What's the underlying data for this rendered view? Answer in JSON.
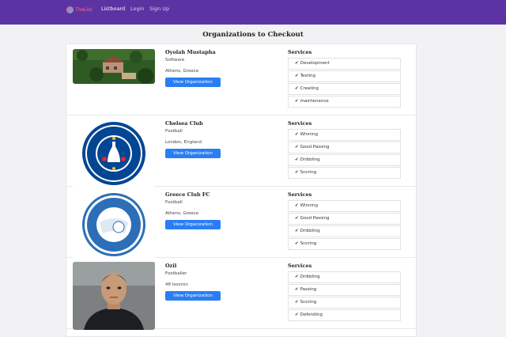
{
  "nav": {
    "brand": "TheList",
    "links": [
      "Listboard",
      "Login",
      "Sign Up"
    ]
  },
  "page_title": "Organizations to Checkout",
  "organizations": [
    {
      "name": "Oyolah Mustapha",
      "category": "Software",
      "location": "Athens, Greece",
      "button": "View Organization",
      "services_title": "Services",
      "services": [
        "Development",
        "Testing",
        "Creating",
        "maintenance"
      ]
    },
    {
      "name": "Chelsea Club",
      "category": "Football",
      "location": "London, England",
      "button": "View Organization",
      "services_title": "Services",
      "services": [
        "Winning",
        "Good Passing",
        "Dribbling",
        "Scoring"
      ]
    },
    {
      "name": "Greece Club FC",
      "category": "Football",
      "location": "Athens, Greece",
      "button": "View Organization",
      "services_title": "Services",
      "services": [
        "Winning",
        "Good Passing",
        "Dribbling",
        "Scoring"
      ]
    },
    {
      "name": "Ozil",
      "category": "Footballer",
      "location": "48 Isovron",
      "button": "View Organization",
      "services_title": "Services",
      "services": [
        "Dribbling",
        "Passing",
        "Scoring",
        "Defending"
      ]
    }
  ]
}
